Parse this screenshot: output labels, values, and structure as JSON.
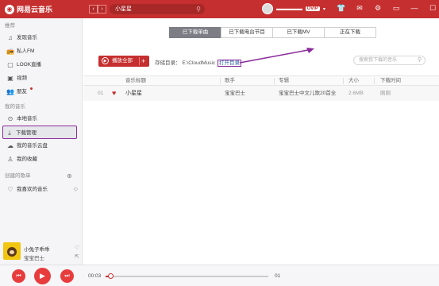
{
  "app": {
    "title": "网易云音乐"
  },
  "search": {
    "value": "小星星"
  },
  "user": {
    "name": "▬▬▬▬▬",
    "vip": "OVIP"
  },
  "sidebar": {
    "sections": {
      "recommend": "推荐",
      "my_music": "我的音乐",
      "created_playlists": "创建的歌单"
    },
    "recommend_items": [
      {
        "label": "发现音乐",
        "icon": "music-note-icon"
      },
      {
        "label": "私人FM",
        "icon": "radio-icon"
      },
      {
        "label": "LOOK直播",
        "icon": "live-icon"
      },
      {
        "label": "视频",
        "icon": "video-icon"
      },
      {
        "label": "朋友",
        "icon": "friends-icon"
      }
    ],
    "my_music_items": [
      {
        "label": "本地音乐",
        "icon": "local-music-icon"
      },
      {
        "label": "下载管理",
        "icon": "download-icon"
      },
      {
        "label": "我的音乐云盘",
        "icon": "cloud-icon"
      },
      {
        "label": "我的收藏",
        "icon": "collection-icon"
      }
    ],
    "playlist_items": [
      {
        "label": "我喜欢的音乐",
        "icon": "heart-icon"
      }
    ]
  },
  "tabs": [
    {
      "label": "已下载单曲",
      "active": true
    },
    {
      "label": "已下载电台节目",
      "active": false
    },
    {
      "label": "已下载MV",
      "active": false
    },
    {
      "label": "正在下载",
      "active": false
    }
  ],
  "toolbar": {
    "play_all": "播放全部",
    "storage_label": "存储目录：",
    "storage_path": "E:\\CloudMusic",
    "open_dir": "打开目录",
    "search_placeholder": "搜索我下载的音乐"
  },
  "table": {
    "headers": [
      "音乐标题",
      "歌手",
      "专辑",
      "大小",
      "下载时间"
    ],
    "rows": [
      {
        "num": "01",
        "title": "小星星",
        "artist": "宝宝巴士",
        "album": "宝宝巴士中文儿歌20首全",
        "size": "2.6MB",
        "time": "刚刚"
      }
    ]
  },
  "now_playing": {
    "title": "小兔子乖乖",
    "artist": "宝宝巴士"
  },
  "player": {
    "current_time": "00:03",
    "total_time": "01",
    "progress": 0.03
  },
  "colors": {
    "brand": "#c62f2f",
    "annotation": "#8a2a9a"
  }
}
